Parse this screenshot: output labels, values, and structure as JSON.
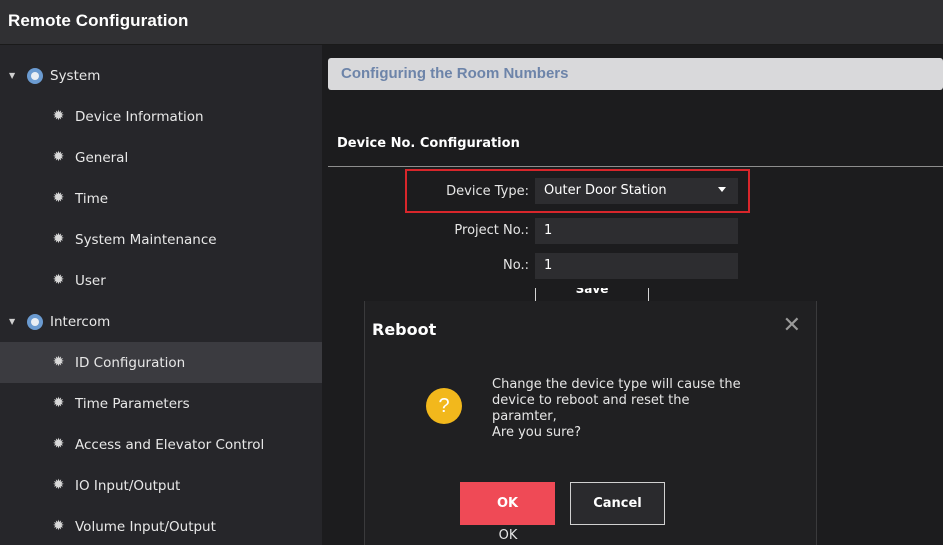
{
  "app": {
    "title": "Remote Configuration"
  },
  "sidebar": {
    "groups": [
      {
        "label": "System",
        "items": [
          "Device Information",
          "General",
          "Time",
          "System Maintenance",
          "User"
        ]
      },
      {
        "label": "Intercom",
        "items": [
          "ID Configuration",
          "Time Parameters",
          "Access and Elevator Control",
          "IO Input/Output",
          "Volume Input/Output"
        ]
      }
    ],
    "selected_item": "ID Configuration"
  },
  "main": {
    "section_title": "Configuring the Room Numbers",
    "subsection_title": "Device No. Configuration",
    "form": {
      "device_type": {
        "label": "Device Type:",
        "value": "Outer Door Station"
      },
      "project_no": {
        "label": "Project No.:",
        "value": "1"
      },
      "no": {
        "label": "No.:",
        "value": "1"
      },
      "save_label": "Save"
    }
  },
  "dialog": {
    "title": "Reboot",
    "message_lines": [
      "Change the device type will cause the",
      "device to reboot and reset the",
      "paramter,",
      "Are you sure?"
    ],
    "icon_glyph": "?",
    "ok_label": "OK",
    "cancel_label": "Cancel",
    "caption": "OK"
  },
  "colors": {
    "accent": "#ef4a56",
    "warning": "#f2b81c",
    "highlight": "#d8262b",
    "section_text": "#6d84a9"
  },
  "icons": {
    "group": "globe-icon",
    "item": "gear-icon",
    "close": "close-icon",
    "dropdown": "chevron-down-icon",
    "warning": "question-icon"
  }
}
